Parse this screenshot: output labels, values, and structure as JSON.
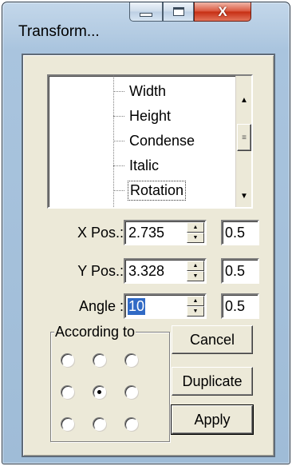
{
  "window": {
    "title": "Transform..."
  },
  "caption_buttons": {
    "minimize_icon": "minimize-icon",
    "maximize_icon": "maximize-icon",
    "close_icon": "close-icon",
    "close_glyph": "X"
  },
  "list": {
    "items": [
      {
        "label": "Width",
        "selected": false
      },
      {
        "label": "Height",
        "selected": false
      },
      {
        "label": "Condense",
        "selected": false
      },
      {
        "label": "Italic",
        "selected": false
      },
      {
        "label": "Rotation",
        "selected": true
      }
    ],
    "scroll_up_glyph": "▲",
    "scroll_down_glyph": "▼",
    "thumb_glyph": "≡"
  },
  "fields": {
    "x_pos": {
      "label": "X Pos.:",
      "value": "2.735",
      "step": "0.5"
    },
    "y_pos": {
      "label": "Y Pos.:",
      "value": "3.328",
      "step": "0.5"
    },
    "angle": {
      "label": "Angle :",
      "value": "10",
      "step": "0.5"
    }
  },
  "according_to": {
    "title": "According to",
    "selected_index": 4
  },
  "buttons": {
    "cancel": "Cancel",
    "duplicate": "Duplicate",
    "apply": "Apply"
  },
  "spin_glyphs": {
    "up": "▲",
    "down": "▼"
  },
  "colors": {
    "selection": "#316ac5",
    "face": "#ece9d8",
    "close": "#c62d12"
  }
}
